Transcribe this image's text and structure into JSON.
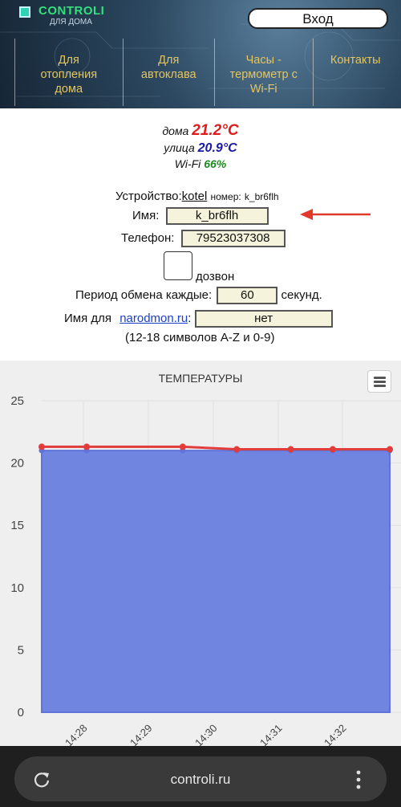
{
  "header": {
    "logo_text": "CONTROLI",
    "logo_sub": "ДЛЯ ДОМА",
    "login_label": "Вход",
    "nav": [
      {
        "label": "Для отопления дома"
      },
      {
        "label": "Для автоклава"
      },
      {
        "label": "Часы - термометр с Wi-Fi"
      },
      {
        "label": "Контакты"
      }
    ]
  },
  "readings": {
    "home_label": "дома",
    "home_value": "21.2°C",
    "street_label": "улица",
    "street_value": "20.9°C",
    "wifi_label": "Wi-Fi",
    "wifi_value": "66%"
  },
  "device": {
    "label": "Устройство:",
    "name": "kotel",
    "number_label": "номер:",
    "number": "k_br6flh",
    "name_field_label": "Имя:",
    "name_field_value": "k_br6flh",
    "phone_label": "Телефон:",
    "phone_value": "79523037308",
    "callback_label": "дозвон",
    "period_label": "Период обмена каждые:",
    "period_value": "60",
    "period_unit": "секунд.",
    "narodmon_prefix": "Имя для",
    "narodmon_link": "narodmon.ru",
    "narodmon_colon": ":",
    "narodmon_value": "нет",
    "narodmon_hint": "(12-18 символов A-Z и 0-9)"
  },
  "chart_data": {
    "type": "area",
    "title": "ТЕМПЕРАТУРЫ",
    "ylim": [
      0,
      25
    ],
    "yticks": [
      0,
      5,
      10,
      15,
      20,
      25
    ],
    "xticks": [
      "14:28",
      "14:29",
      "14:30",
      "14:31",
      "14:32"
    ],
    "grid": true,
    "series": [
      {
        "color": "#7085e0",
        "values": [
          21.0,
          21.0,
          21.0,
          21.0,
          21.0,
          21.0,
          21.0
        ]
      },
      {
        "color": "#e03c3c",
        "values": [
          21.3,
          21.3,
          21.3,
          21.1,
          21.1,
          21.1,
          21.1
        ]
      }
    ],
    "x": [
      14.455,
      14.47,
      14.502,
      14.52,
      14.538,
      14.552,
      14.571
    ]
  },
  "browser": {
    "url": "controli.ru"
  },
  "colors": {
    "accent_red": "#dd1c1c",
    "accent_blue": "#1a1aa8",
    "accent_green": "#1e8a1e",
    "field_bg": "#f5f3dc"
  }
}
